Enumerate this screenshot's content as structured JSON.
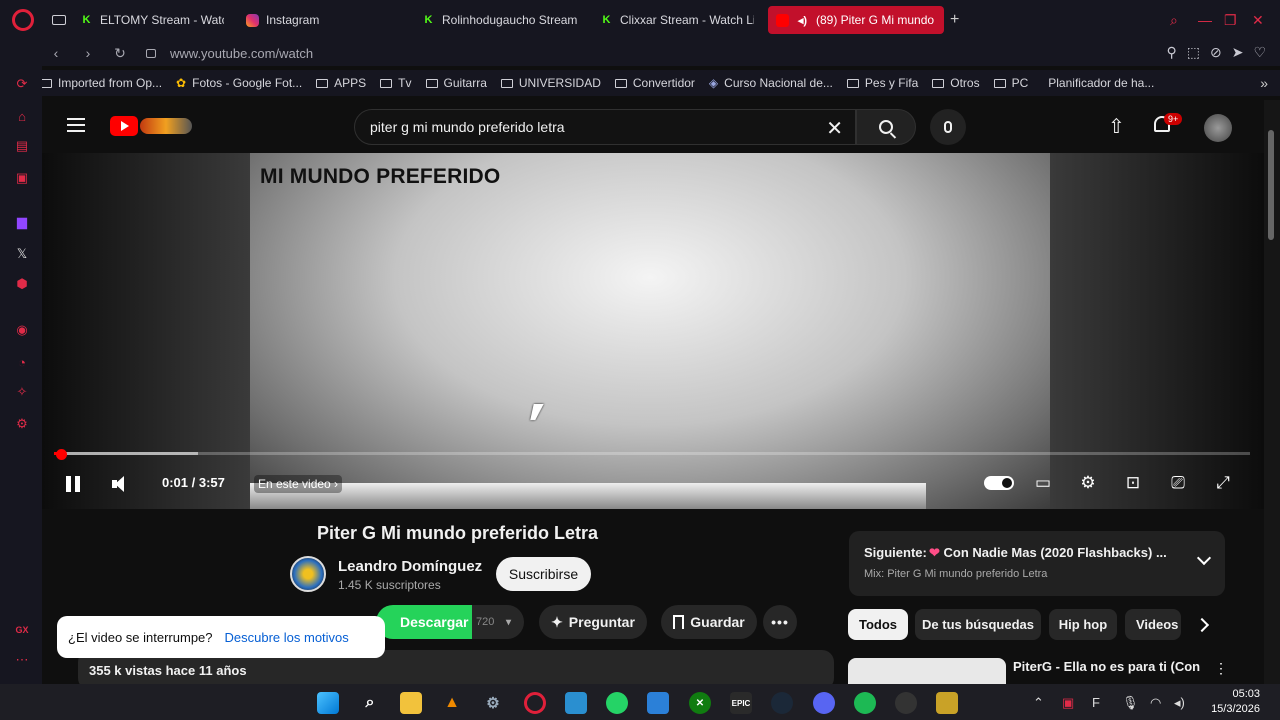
{
  "browser": {
    "tabs": [
      {
        "label": "ELTOMY Stream - Watch L",
        "icon": "kick-icon",
        "color": "#53fc18"
      },
      {
        "label": "Instagram",
        "icon": "instagram-icon",
        "color": "#e1306c"
      },
      {
        "label": "Rolinhodugaucho Stream",
        "icon": "kick-icon",
        "color": "#53fc18"
      },
      {
        "label": "Clixxar Stream - Watch Li",
        "icon": "kick-icon",
        "color": "#53fc18"
      },
      {
        "label": "(89) Piter G Mi mundo",
        "icon": "youtube-icon",
        "color": "#ff0000",
        "active": true
      }
    ],
    "url": "www.youtube.com/watch",
    "bookmarks": [
      "Imported from Op...",
      "Fotos - Google Fot...",
      "APPS",
      "Tv",
      "Guitarra",
      "UNIVERSIDAD",
      "Convertidor",
      "Curso Nacional de...",
      "Pes y Fifa",
      "Otros",
      "PC",
      "Planificador de ha..."
    ],
    "accent_color": "#e02b48"
  },
  "youtube": {
    "search_query": "piter g mi mundo preferido letra",
    "notification_count": "9+",
    "player": {
      "overlay_title": "MI MUNDO PREFERIDO",
      "time_current": "0:01",
      "time_total": "3:57",
      "time_display": "0:01 / 3:57",
      "chapter_label": "En este video",
      "progress_played": 0.004,
      "progress_loaded": 0.12
    },
    "video": {
      "title": "Piter G Mi mundo preferido Letra",
      "channel": "Leandro Domínguez",
      "subscribers": "1.45 K suscriptores",
      "subscribe_label": "Suscribirse",
      "download_label": "Descargar",
      "download_quality": "720",
      "ask_label": "Preguntar",
      "save_label": "Guardar",
      "views": "355 k vistas  hace 11 años"
    },
    "popup": {
      "question": "¿El video se interrumpe?",
      "link": "Descubre los motivos"
    },
    "up_next": {
      "label": "Siguiente:",
      "title": "Con Nadie Mas (2020 Flashbacks) ...",
      "mix": "Mix: Piter G Mi mundo preferido Letra"
    },
    "chips": [
      "Todos",
      "De tus búsquedas",
      "Hip hop",
      "Videos"
    ],
    "recommendation": {
      "title": "PiterG - Ella no es para ti (Con"
    }
  },
  "taskbar": {
    "time": "05:03",
    "date": "15/3/2026"
  }
}
